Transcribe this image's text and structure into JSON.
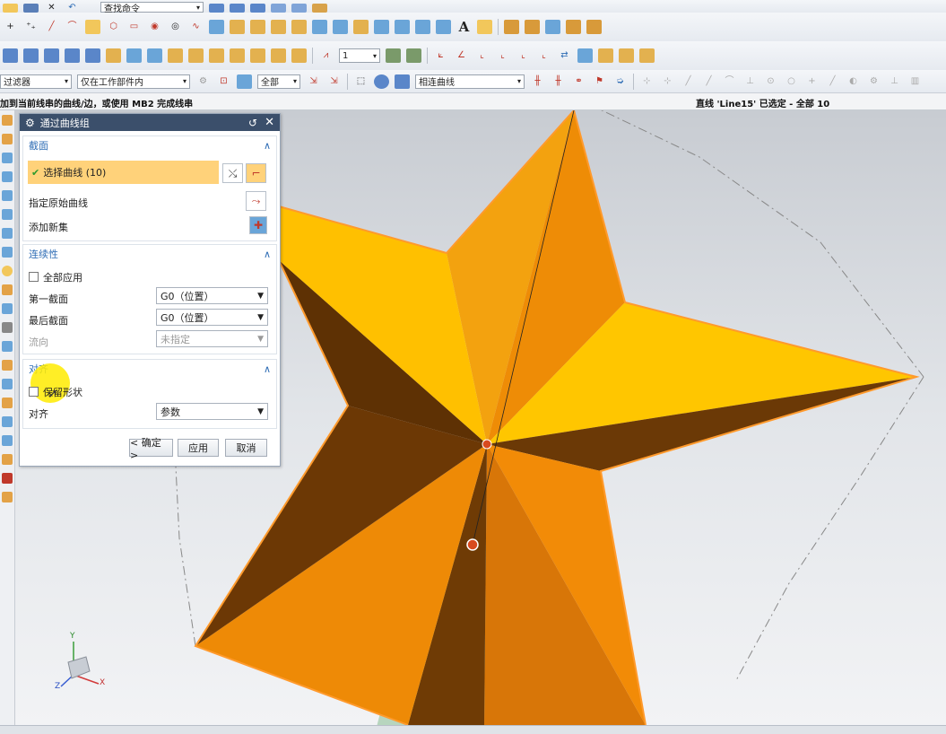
{
  "toolbar": {
    "row3": {
      "number_combo": "1"
    },
    "row4": {
      "filter_combo": "过滤器",
      "scope_combo": "仅在工作部件内",
      "select_all_combo": "全部",
      "curve_rule_combo": "相连曲线"
    },
    "search_combo": "查找命令",
    "text_tool_label": "A"
  },
  "status": {
    "prompt": "加到当前线串的曲线/边，或使用 MB2 完成线串",
    "selection": "直线 'Line15' 已选定 - 全部 10"
  },
  "dialog": {
    "title": "通过曲线组",
    "section_label": "截面",
    "select_curve": "选择曲线 (10)",
    "specify_origin": "指定原始曲线",
    "add_new_set": "添加新集",
    "continuity": {
      "header": "连续性",
      "apply_all": "全部应用",
      "first_section_label": "第一截面",
      "first_section_value": "G0（位置）",
      "last_section_label": "最后截面",
      "last_section_value": "G0（位置）",
      "flow_label": "流向",
      "flow_value": "未指定"
    },
    "alignment": {
      "header": "对齐",
      "keep_shape": "保留形状",
      "align_label": "对齐",
      "align_value": "参数"
    },
    "buttons": {
      "ok": "< 确定 >",
      "apply": "应用",
      "cancel": "取消"
    }
  },
  "triad": {
    "x": "X",
    "y": "Y",
    "z": "Z"
  },
  "colors": {
    "star_light": "#ffcc00",
    "star_mid": "#f0900a",
    "star_dark": "#6e3a05",
    "dialog_title": "#3b4f6b",
    "section_header": "#2f6db5",
    "highlight_row": "#ffd27a"
  }
}
